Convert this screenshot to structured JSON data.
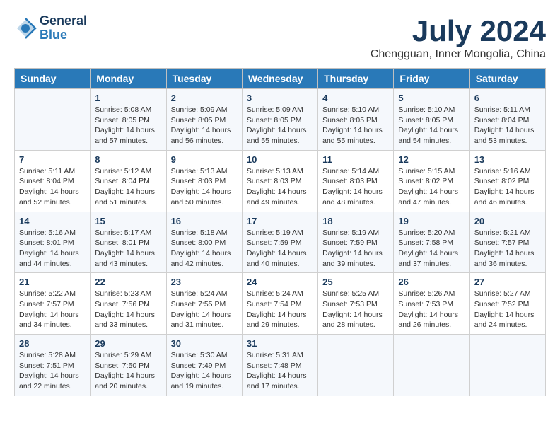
{
  "header": {
    "logo_general": "General",
    "logo_blue": "Blue",
    "title": "July 2024",
    "subtitle": "Chengguan, Inner Mongolia, China"
  },
  "days_of_week": [
    "Sunday",
    "Monday",
    "Tuesday",
    "Wednesday",
    "Thursday",
    "Friday",
    "Saturday"
  ],
  "weeks": [
    [
      {
        "day": "",
        "info": ""
      },
      {
        "day": "1",
        "info": "Sunrise: 5:08 AM\nSunset: 8:05 PM\nDaylight: 14 hours\nand 57 minutes."
      },
      {
        "day": "2",
        "info": "Sunrise: 5:09 AM\nSunset: 8:05 PM\nDaylight: 14 hours\nand 56 minutes."
      },
      {
        "day": "3",
        "info": "Sunrise: 5:09 AM\nSunset: 8:05 PM\nDaylight: 14 hours\nand 55 minutes."
      },
      {
        "day": "4",
        "info": "Sunrise: 5:10 AM\nSunset: 8:05 PM\nDaylight: 14 hours\nand 55 minutes."
      },
      {
        "day": "5",
        "info": "Sunrise: 5:10 AM\nSunset: 8:05 PM\nDaylight: 14 hours\nand 54 minutes."
      },
      {
        "day": "6",
        "info": "Sunrise: 5:11 AM\nSunset: 8:04 PM\nDaylight: 14 hours\nand 53 minutes."
      }
    ],
    [
      {
        "day": "7",
        "info": "Sunrise: 5:11 AM\nSunset: 8:04 PM\nDaylight: 14 hours\nand 52 minutes."
      },
      {
        "day": "8",
        "info": "Sunrise: 5:12 AM\nSunset: 8:04 PM\nDaylight: 14 hours\nand 51 minutes."
      },
      {
        "day": "9",
        "info": "Sunrise: 5:13 AM\nSunset: 8:03 PM\nDaylight: 14 hours\nand 50 minutes."
      },
      {
        "day": "10",
        "info": "Sunrise: 5:13 AM\nSunset: 8:03 PM\nDaylight: 14 hours\nand 49 minutes."
      },
      {
        "day": "11",
        "info": "Sunrise: 5:14 AM\nSunset: 8:03 PM\nDaylight: 14 hours\nand 48 minutes."
      },
      {
        "day": "12",
        "info": "Sunrise: 5:15 AM\nSunset: 8:02 PM\nDaylight: 14 hours\nand 47 minutes."
      },
      {
        "day": "13",
        "info": "Sunrise: 5:16 AM\nSunset: 8:02 PM\nDaylight: 14 hours\nand 46 minutes."
      }
    ],
    [
      {
        "day": "14",
        "info": "Sunrise: 5:16 AM\nSunset: 8:01 PM\nDaylight: 14 hours\nand 44 minutes."
      },
      {
        "day": "15",
        "info": "Sunrise: 5:17 AM\nSunset: 8:01 PM\nDaylight: 14 hours\nand 43 minutes."
      },
      {
        "day": "16",
        "info": "Sunrise: 5:18 AM\nSunset: 8:00 PM\nDaylight: 14 hours\nand 42 minutes."
      },
      {
        "day": "17",
        "info": "Sunrise: 5:19 AM\nSunset: 7:59 PM\nDaylight: 14 hours\nand 40 minutes."
      },
      {
        "day": "18",
        "info": "Sunrise: 5:19 AM\nSunset: 7:59 PM\nDaylight: 14 hours\nand 39 minutes."
      },
      {
        "day": "19",
        "info": "Sunrise: 5:20 AM\nSunset: 7:58 PM\nDaylight: 14 hours\nand 37 minutes."
      },
      {
        "day": "20",
        "info": "Sunrise: 5:21 AM\nSunset: 7:57 PM\nDaylight: 14 hours\nand 36 minutes."
      }
    ],
    [
      {
        "day": "21",
        "info": "Sunrise: 5:22 AM\nSunset: 7:57 PM\nDaylight: 14 hours\nand 34 minutes."
      },
      {
        "day": "22",
        "info": "Sunrise: 5:23 AM\nSunset: 7:56 PM\nDaylight: 14 hours\nand 33 minutes."
      },
      {
        "day": "23",
        "info": "Sunrise: 5:24 AM\nSunset: 7:55 PM\nDaylight: 14 hours\nand 31 minutes."
      },
      {
        "day": "24",
        "info": "Sunrise: 5:24 AM\nSunset: 7:54 PM\nDaylight: 14 hours\nand 29 minutes."
      },
      {
        "day": "25",
        "info": "Sunrise: 5:25 AM\nSunset: 7:53 PM\nDaylight: 14 hours\nand 28 minutes."
      },
      {
        "day": "26",
        "info": "Sunrise: 5:26 AM\nSunset: 7:53 PM\nDaylight: 14 hours\nand 26 minutes."
      },
      {
        "day": "27",
        "info": "Sunrise: 5:27 AM\nSunset: 7:52 PM\nDaylight: 14 hours\nand 24 minutes."
      }
    ],
    [
      {
        "day": "28",
        "info": "Sunrise: 5:28 AM\nSunset: 7:51 PM\nDaylight: 14 hours\nand 22 minutes."
      },
      {
        "day": "29",
        "info": "Sunrise: 5:29 AM\nSunset: 7:50 PM\nDaylight: 14 hours\nand 20 minutes."
      },
      {
        "day": "30",
        "info": "Sunrise: 5:30 AM\nSunset: 7:49 PM\nDaylight: 14 hours\nand 19 minutes."
      },
      {
        "day": "31",
        "info": "Sunrise: 5:31 AM\nSunset: 7:48 PM\nDaylight: 14 hours\nand 17 minutes."
      },
      {
        "day": "",
        "info": ""
      },
      {
        "day": "",
        "info": ""
      },
      {
        "day": "",
        "info": ""
      }
    ]
  ]
}
